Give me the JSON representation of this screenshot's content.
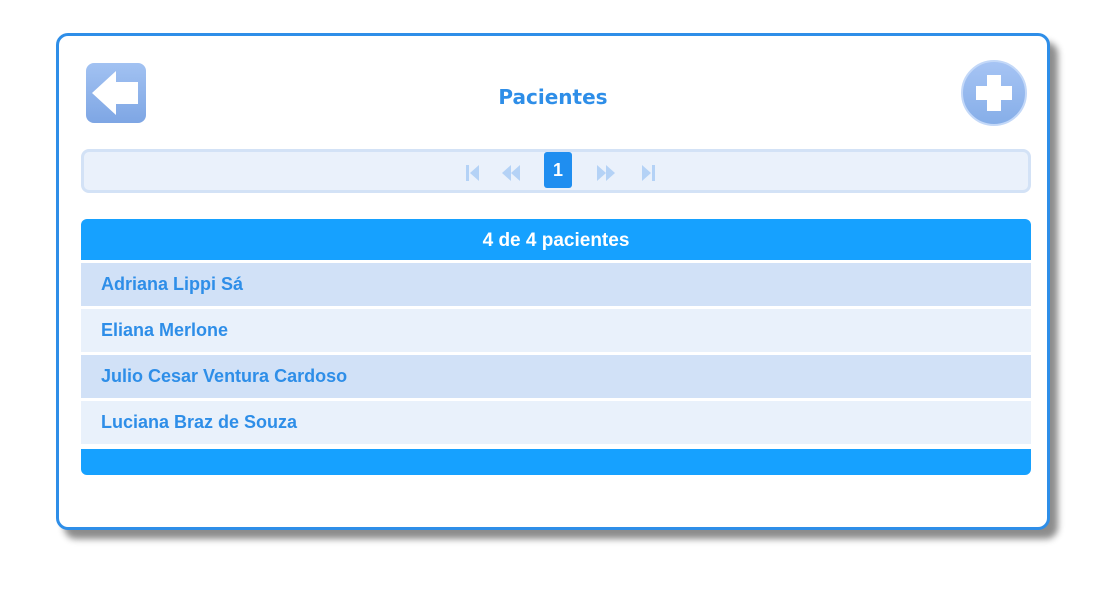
{
  "header": {
    "title": "Pacientes",
    "back_icon": "arrow-left-icon",
    "add_icon": "plus-icon"
  },
  "pager": {
    "current_page": "1",
    "icons": [
      "first-page-icon",
      "previous-page-icon",
      "next-page-icon",
      "last-page-icon"
    ]
  },
  "list": {
    "header": "4 de 4 pacientes",
    "items": [
      {
        "name": "Adriana Lippi Sá"
      },
      {
        "name": "Eliana Merlone"
      },
      {
        "name": "Julio Cesar Ventura Cardoso"
      },
      {
        "name": "Luciana Braz de Souza"
      }
    ]
  },
  "colors": {
    "accent": "#2e8ee8",
    "header_bar": "#16a1ff",
    "row_odd": "#d1e1f7",
    "row_even": "#e9f1fb"
  }
}
